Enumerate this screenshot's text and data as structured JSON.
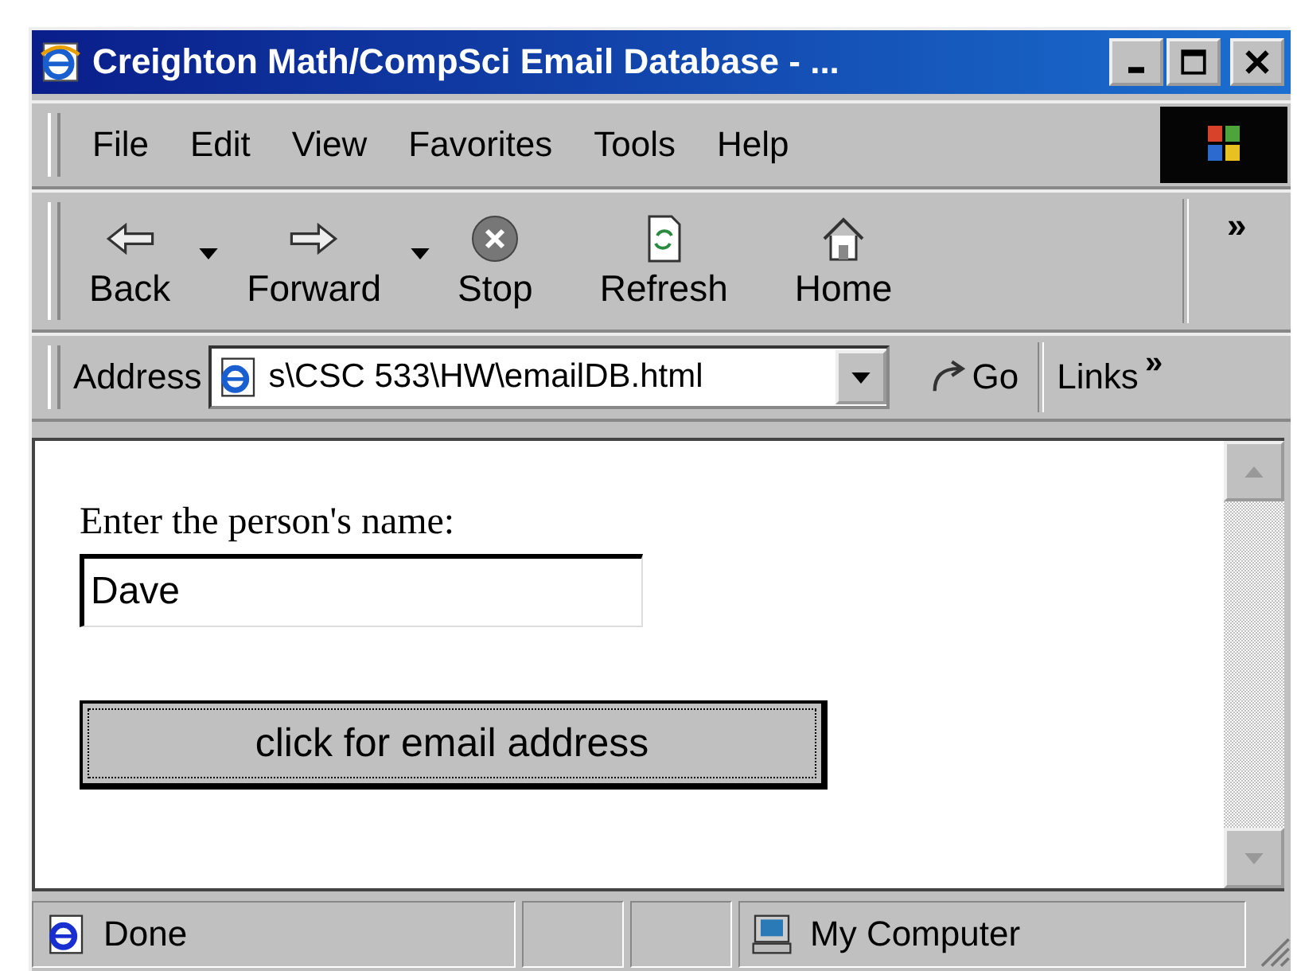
{
  "window": {
    "title": "Creighton Math/CompSci Email Database - ..."
  },
  "menu": [
    {
      "label": "File"
    },
    {
      "label": "Edit"
    },
    {
      "label": "View"
    },
    {
      "label": "Favorites"
    },
    {
      "label": "Tools"
    },
    {
      "label": "Help"
    }
  ],
  "toolbar": {
    "buttons": [
      {
        "label": "Back",
        "kind": "back",
        "dropdown": true
      },
      {
        "label": "Forward",
        "kind": "forward",
        "dropdown": true
      },
      {
        "label": "Stop",
        "kind": "stop",
        "dropdown": false
      },
      {
        "label": "Refresh",
        "kind": "refresh",
        "dropdown": false
      },
      {
        "label": "Home",
        "kind": "home",
        "dropdown": false
      }
    ],
    "more": "»"
  },
  "address_bar": {
    "label": "Address",
    "value": "s\\CSC 533\\HW\\emailDB.html",
    "go": "Go",
    "links": "Links",
    "more": "»"
  },
  "page": {
    "prompt": "Enter the person's name:",
    "name_field": {
      "value": "Dave"
    },
    "button": "click for email address"
  },
  "status_bar": {
    "text": "Done",
    "zone": "My Computer"
  }
}
